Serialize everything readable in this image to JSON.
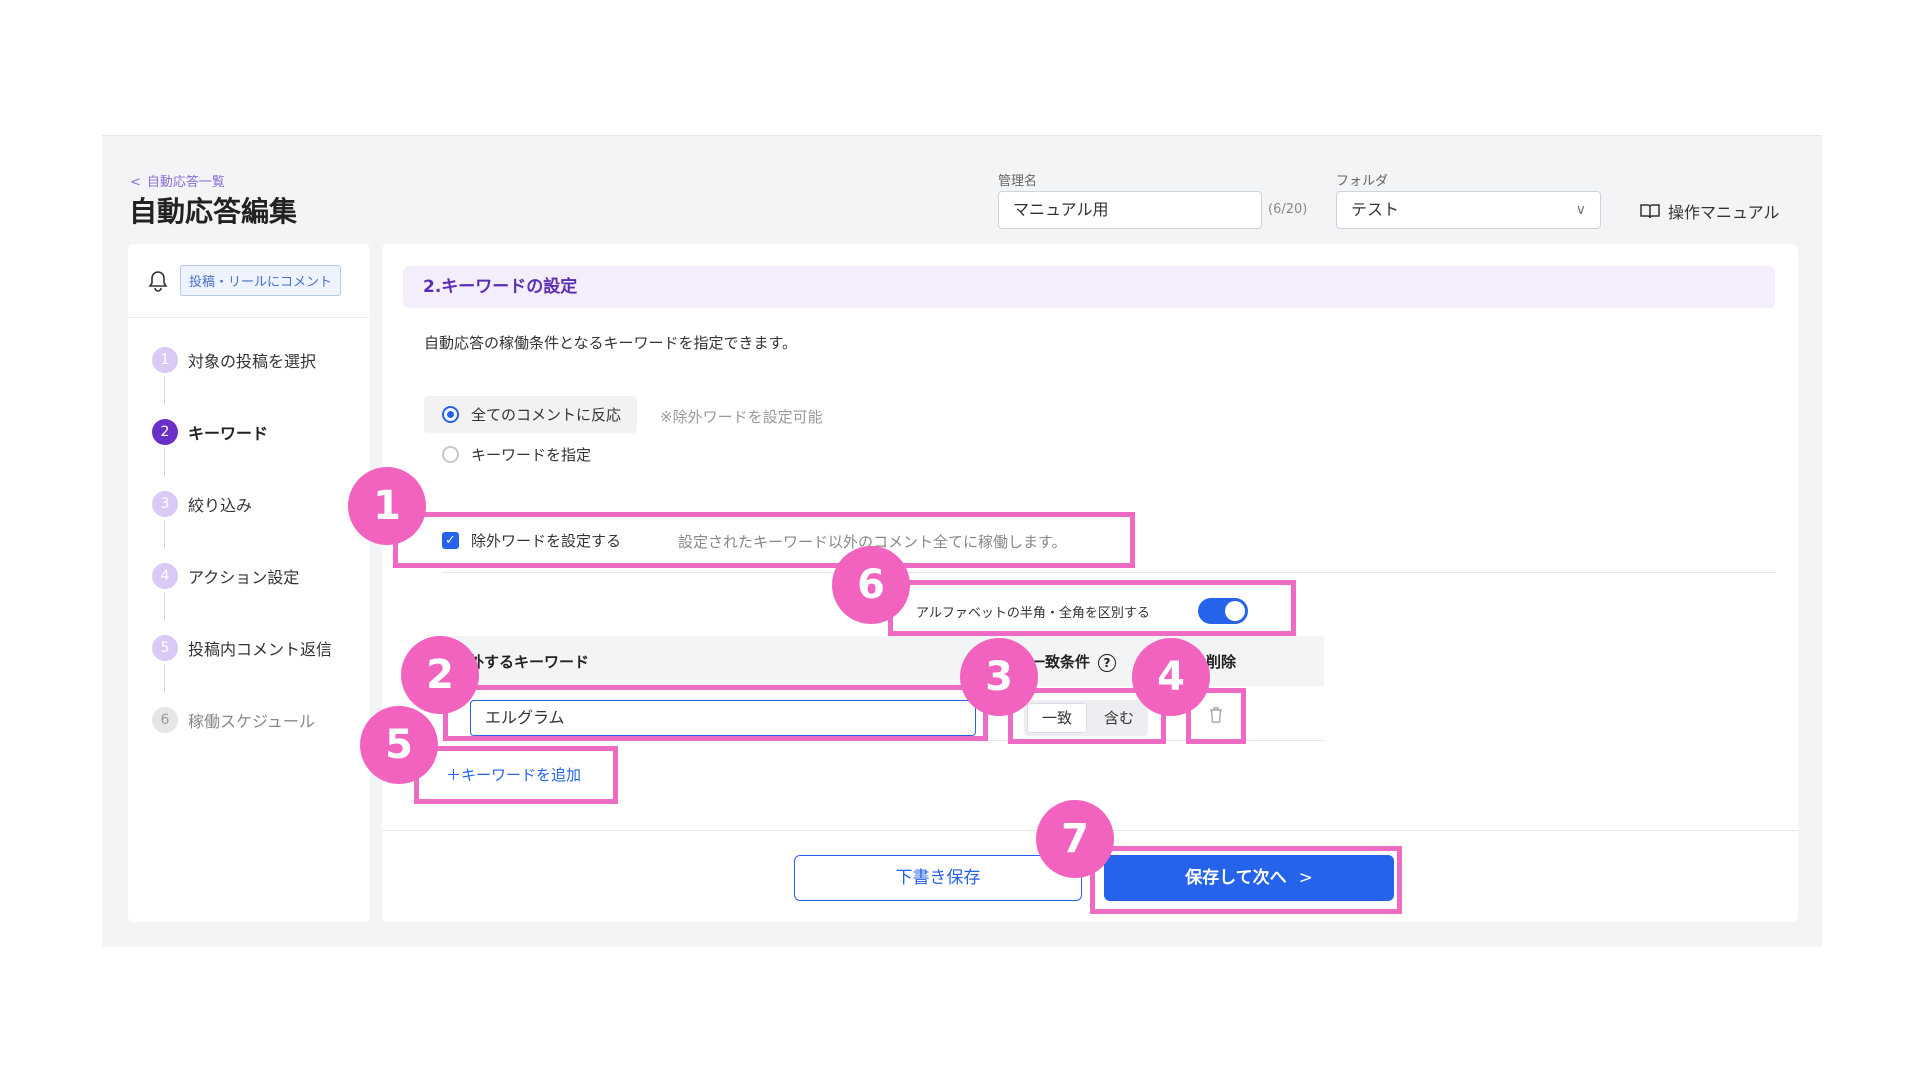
{
  "header": {
    "back_link": "自動応答一覧",
    "title": "自動応答編集",
    "manage_name_label": "管理名",
    "manage_name_value": "マニュアル用",
    "manage_name_counter": "(6/20)",
    "folder_label": "フォルダ",
    "folder_value": "テスト",
    "manual_link": "操作マニュアル"
  },
  "sidebar": {
    "trigger_badge": "投稿・リールにコメント",
    "steps": [
      {
        "num": "1",
        "label": "対象の投稿を選択"
      },
      {
        "num": "2",
        "label": "キーワード"
      },
      {
        "num": "3",
        "label": "絞り込み"
      },
      {
        "num": "4",
        "label": "アクション設定"
      },
      {
        "num": "5",
        "label": "投稿内コメント返信"
      },
      {
        "num": "6",
        "label": "稼働スケジュール"
      }
    ]
  },
  "main": {
    "section_title": "2.キーワードの設定",
    "description": "自動応答の稼働条件となるキーワードを指定できます。",
    "radio_all": "全てのコメントに反応",
    "radio_all_note": "※除外ワードを設定可能",
    "radio_keyword": "キーワードを指定",
    "exclude_checkbox": "除外ワードを設定する",
    "exclude_note": "設定されたキーワード以外のコメント全てに稼働します。",
    "toggle_label": "アルファベットの半角・全角を区別する",
    "table": {
      "col_keyword": "除外するキーワード",
      "col_match": "一致条件",
      "col_delete": "削除",
      "rows": [
        {
          "keyword": "エルグラム",
          "match_options": [
            "一致",
            "含む"
          ]
        }
      ]
    },
    "add_keyword": "＋キーワードを追加",
    "draft_button": "下書き保存",
    "next_button": "保存して次へ"
  },
  "annotations": {
    "markers": [
      "1",
      "2",
      "3",
      "4",
      "5",
      "6",
      "7"
    ]
  },
  "colors": {
    "accent": "#2563eb",
    "purple": "#6a2fc7",
    "highlight": "#ee6bc4"
  },
  "state": {
    "radio_selected": "all",
    "exclude_checked": true,
    "toggle_on": true,
    "active_step": 2,
    "selected_match": "一致"
  }
}
